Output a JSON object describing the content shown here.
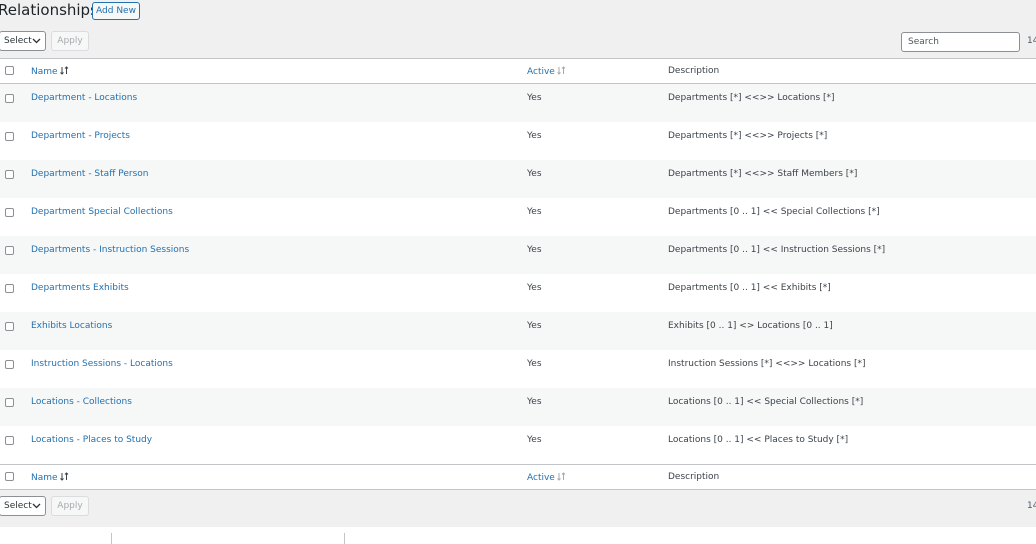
{
  "page": {
    "title": "Relationships",
    "add_new_label": "Add New"
  },
  "bulk": {
    "select_label": "Select",
    "apply_label": "Apply"
  },
  "search": {
    "placeholder": "Search"
  },
  "count": "14",
  "columns": {
    "name": "Name",
    "active": "Active",
    "description": "Description"
  },
  "rows": [
    {
      "name": "Department - Locations",
      "active": "Yes",
      "description": "Departments [*] <<>> Locations [*]"
    },
    {
      "name": "Department - Projects",
      "active": "Yes",
      "description": "Departments [*] <<>> Projects [*]"
    },
    {
      "name": "Department - Staff Person",
      "active": "Yes",
      "description": "Departments [*] <<>> Staff Members [*]"
    },
    {
      "name": "Department Special Collections",
      "active": "Yes",
      "description": "Departments [0 .. 1] << Special Collections [*]"
    },
    {
      "name": "Departments - Instruction Sessions",
      "active": "Yes",
      "description": "Departments [0 .. 1] << Instruction Sessions [*]"
    },
    {
      "name": "Departments Exhibits",
      "active": "Yes",
      "description": "Departments [0 .. 1] << Exhibits [*]"
    },
    {
      "name": "Exhibits Locations",
      "active": "Yes",
      "description": "Exhibits [0 .. 1] <> Locations [0 .. 1]"
    },
    {
      "name": "Instruction Sessions - Locations",
      "active": "Yes",
      "description": "Instruction Sessions [*] <<>> Locations [*]"
    },
    {
      "name": "Locations - Collections",
      "active": "Yes",
      "description": "Locations [0 .. 1] << Special Collections [*]"
    },
    {
      "name": "Locations - Places to Study",
      "active": "Yes",
      "description": "Locations [0 .. 1] << Places to Study [*]"
    }
  ]
}
